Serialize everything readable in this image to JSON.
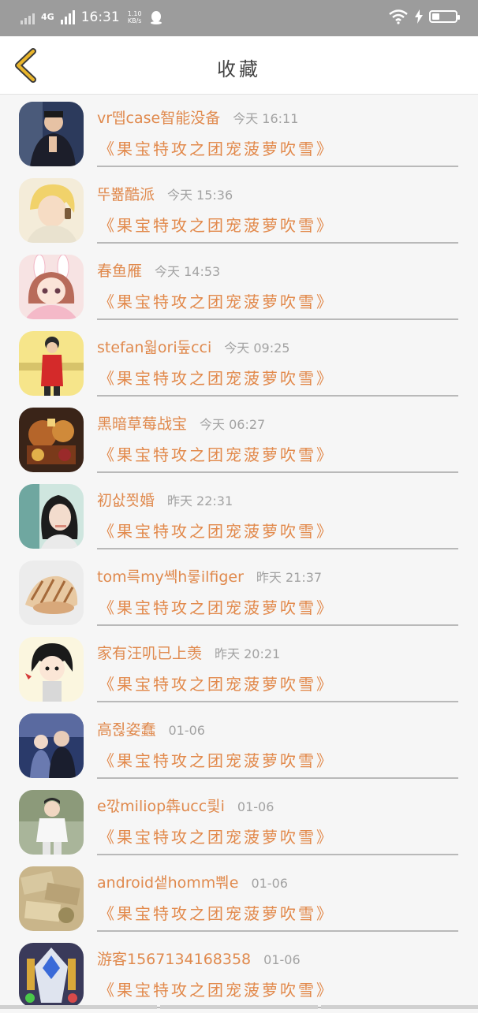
{
  "status_bar": {
    "network": "4G",
    "time": "16:31",
    "speed": "1.10 KB/s",
    "colors": {
      "bg": "#9c9c9c"
    }
  },
  "header": {
    "title": "收藏",
    "back_icon": "chevron-left-icon",
    "accent": "#e9b52b"
  },
  "items": [
    {
      "name": "vr뗍case智能没备",
      "time": "今天 16:11",
      "book": "《果宝特攻之团宠菠萝吹雪》",
      "avatar": "man-in-suit"
    },
    {
      "name": "뚜뾺酷派",
      "time": "今天 15:36",
      "book": "《果宝特攻之团宠菠萝吹雪》",
      "avatar": "blond-anime-boy"
    },
    {
      "name": "春鱼雁",
      "time": "今天 14:53",
      "book": "《果宝特攻之团宠菠萝吹雪》",
      "avatar": "pink-anime-girl"
    },
    {
      "name": "stefan웗ori둪cci",
      "time": "今天 09:25",
      "book": "《果宝特攻之团宠菠萝吹雪》",
      "avatar": "boy-red-shirt"
    },
    {
      "name": "黑暗草莓战宝",
      "time": "今天 06:27",
      "book": "《果宝特攻之团宠菠萝吹雪》",
      "avatar": "robot-toy"
    },
    {
      "name": "初삾쬣婚",
      "time": "昨天 22:31",
      "book": "《果宝特攻之团宠菠萝吹雪》",
      "avatar": "girl-selfie"
    },
    {
      "name": "tom륵my쎽h뤃ilfiger",
      "time": "昨天 21:37",
      "book": "《果宝特攻之团宠菠萝吹雪》",
      "avatar": "seashell"
    },
    {
      "name": "家有汪叽已上羡",
      "time": "昨天 20:21",
      "book": "《果宝特攻之团宠菠萝吹雪》",
      "avatar": "chibi-character"
    },
    {
      "name": "高쥖姿蠢",
      "time": "01-06",
      "book": "《果宝特攻之团宠菠萝吹雪》",
      "avatar": "couple-night"
    },
    {
      "name": "e깏miliop犇ucc릧i",
      "time": "01-06",
      "book": "《果宝特攻之团宠菠萝吹雪》",
      "avatar": "boy-white-shirt"
    },
    {
      "name": "android샡homm뿨e",
      "time": "01-06",
      "book": "《果宝特攻之团宠菠萝吹雪》",
      "avatar": "money-pile"
    },
    {
      "name": "游客1567134168358",
      "time": "01-06",
      "book": "《果宝特攻之团宠菠萝吹雪》",
      "avatar": "mecha-robot"
    }
  ]
}
